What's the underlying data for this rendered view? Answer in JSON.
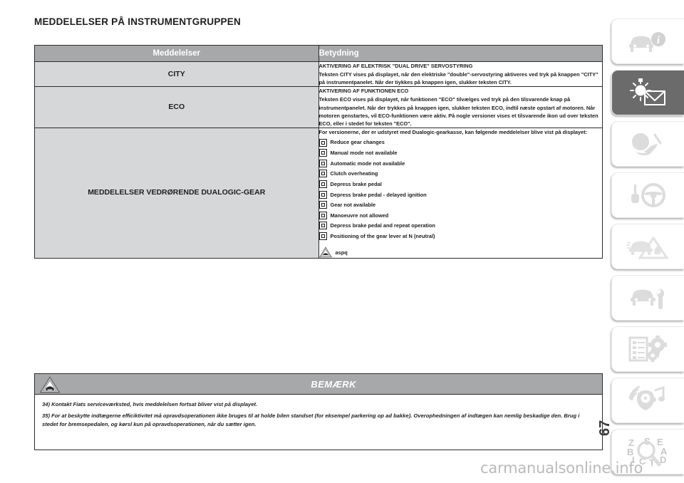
{
  "page": {
    "title": "MEDDELELSER PÅ INSTRUMENTGRUPPEN",
    "page_number": "67",
    "watermark": "carmanualsonline.info",
    "accent_header_color": "#a6a8aa",
    "left_cell_color": "#d6d7d9",
    "border_color": "#2b2b2b",
    "active_tab_color": "#6b6b6b"
  },
  "table": {
    "headers": {
      "messages": "Meddelelser",
      "meaning": "Betydning"
    },
    "rows": [
      {
        "message": "CITY",
        "heading": "AKTIVERING AF ELEKTRISK \"DUAL DRIVE\" SERVOSTYRING",
        "paragraphs": [
          "Teksten CITY vises på displayet, når den elektriske \"double\"-servostyring aktiveres ved tryk på knappen \"CITY\" på instrumentpanelet. Når der tiykkes på knappen igen, slukker teksten CITY."
        ],
        "items": []
      },
      {
        "message": "ECO",
        "heading": "AKTIVERING AF FUNKTIONEN ECO",
        "paragraphs": [
          "Teksten ECO vises på displayet, når funktionen \"ECO\" tilvælges ved tryk på den tilsvarende knap på instrumentpanelet. Når der trykkes på knappen igen, slukker teksten ECO, indtil næste opstart af motoren. Når motoren genstartes, vil ECO-funktionen være aktiv. På nogle versioner vises et tilsvarende ikon ud over teksten ECO, eller i stedet for teksten \"ECO\"."
        ],
        "items": []
      },
      {
        "message": "MEDDELELSER VEDRØRENDE DUALOGIC-GEAR",
        "heading": "",
        "paragraphs": [
          "For versionerne, der er udstyret med Dualogic-gearkasse, kan følgende meddelelser blive vist på displayet:"
        ],
        "items": [
          {
            "icon": "square-icon",
            "label": "Reduce gear changes"
          },
          {
            "icon": "square-icon",
            "label": "Manual mode not available"
          },
          {
            "icon": "square-icon",
            "label": "Automatic mode not available"
          },
          {
            "icon": "square-icon",
            "label": "Clutch overheating"
          },
          {
            "icon": "square-icon",
            "label": "Depress brake pedal"
          },
          {
            "icon": "square-icon",
            "label": "Depress brake pedal - delayed ignition"
          },
          {
            "icon": "square-icon",
            "label": "Gear not available"
          },
          {
            "icon": "square-icon",
            "label": "Manoeuvre not allowed"
          },
          {
            "icon": "square-icon",
            "label": "Depress brake pedal and repeat operation"
          },
          {
            "icon": "square-icon",
            "label": "Positioning of the gear lever at N (neutral)"
          }
        ],
        "final_item": {
          "icon": "warning-triangle-icon",
          "label": "aspq"
        }
      }
    ]
  },
  "note": {
    "label": "BEMÆRK",
    "icon": "warning-triangle-car-icon",
    "paragraphs": [
      "34) Kontakt Fiats serviceværksted, hvis meddelelsen fortsat bliver vist på displayet.",
      "35) For at beskytte indtægerne efficiktivitet må opravdsoperationen ikke bruges til at holde bilen standset (for eksempel parkering op ad bakke). Overophedningen af indtægen kan nemlig beskadige den. Brug i stedet for bremsepedalen, og kørsl kun på opravdsoperationen, når du sætter igen."
    ]
  },
  "sidebar": {
    "items": [
      {
        "name": "dashboard-info",
        "icon": "car-info-icon",
        "active": false
      },
      {
        "name": "warning-lights-messages",
        "icon": "sun-envelope-icon",
        "active": true
      },
      {
        "name": "safety",
        "icon": "airbag-icon",
        "active": false
      },
      {
        "name": "starting-and-driving",
        "icon": "key-steering-wheel-icon",
        "active": false
      },
      {
        "name": "in-an-emergency",
        "icon": "car-hazard-triangle-icon",
        "active": false
      },
      {
        "name": "maintenance-and-care",
        "icon": "car-wrench-icon",
        "active": false
      },
      {
        "name": "technical-specifications",
        "icon": "list-gears-icon",
        "active": false
      },
      {
        "name": "multimedia",
        "icon": "radio-music-icon",
        "active": false
      },
      {
        "name": "alphabetical-index",
        "icon": "index-magnifier-icon",
        "active": false
      }
    ]
  }
}
